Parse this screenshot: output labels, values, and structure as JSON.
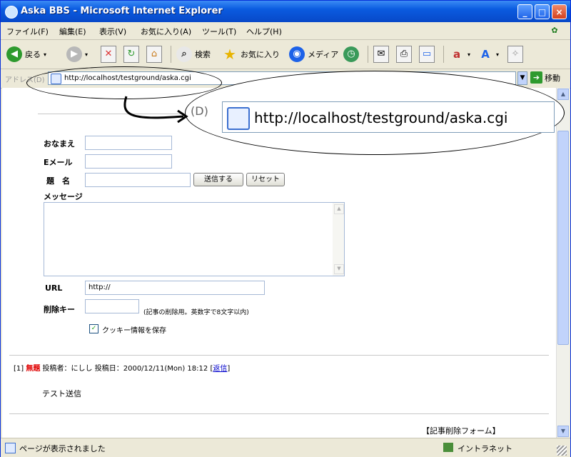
{
  "window": {
    "title": "Aska BBS - Microsoft Internet Explorer",
    "min": "_",
    "max": "□",
    "close": "×"
  },
  "menu": [
    "ファイル(F)",
    "編集(E)",
    "表示(V)",
    "お気に入り(A)",
    "ツール(T)",
    "ヘルプ(H)"
  ],
  "toolbar": {
    "back": "戻る",
    "search": "検索",
    "favorites": "お気に入り",
    "media": "メディア"
  },
  "address": {
    "label": "アドレス(D)",
    "url": "http://localhost/testground/aska.cgi",
    "go": "移動",
    "zoom_label": "(D)"
  },
  "form": {
    "name_label": "おなまえ",
    "email_label": "Eメール",
    "subject_label": "題　名",
    "submit": "送信する",
    "reset": "リセット",
    "message_label": "メッセージ",
    "url_label": "URL",
    "url_value": "http://",
    "delkey_label": "削除キー",
    "delkey_note": "(記事の削除用。英数字で8文字以内)",
    "cookie_label": "クッキー情報を保存",
    "cookie_checked": true
  },
  "post": {
    "number": "[1]",
    "subject": "無題",
    "author_label": "投稿者：",
    "author": "にしし",
    "date_label": "投稿日：",
    "date": "2000/12/11(Mon) 18:12",
    "reply_link": "返信",
    "body": "テスト送信"
  },
  "delete_form_label": "【記事削除フォーム】",
  "status": {
    "text": "ページが表示されました",
    "zone": "イントラネット"
  },
  "colors": {
    "title_bar": "#0a5be0",
    "subject_red": "#e00000",
    "link_blue": "#0000cc"
  }
}
